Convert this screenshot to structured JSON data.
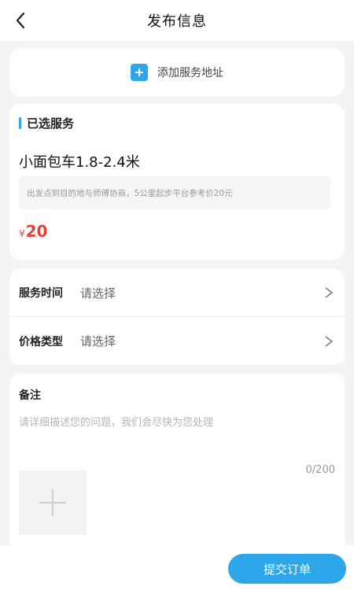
{
  "header": {
    "title": "发布信息",
    "back_icon": "chevron-left-icon"
  },
  "address": {
    "label": "添加服务地址",
    "icon": "plus-icon",
    "accent_color": "#2ea7ea"
  },
  "service": {
    "section_title": "已选服务",
    "name": "小面包车1.8-2.4米",
    "description": "出发点到目的地与师傅协商，5公里起步平台参考价20元",
    "currency": "¥",
    "price": "20",
    "price_color": "#e0453d"
  },
  "options": [
    {
      "label": "服务时间",
      "value": "请选择",
      "chevron": ">"
    },
    {
      "label": "价格类型",
      "value": "请选择",
      "chevron": ">"
    }
  ],
  "notes": {
    "title": "备注",
    "placeholder": "请详细描述您的问题，我们会尽快为您处理",
    "counter": "0/200",
    "upload_icon": "plus-icon"
  },
  "footer": {
    "submit_label": "提交订单"
  }
}
